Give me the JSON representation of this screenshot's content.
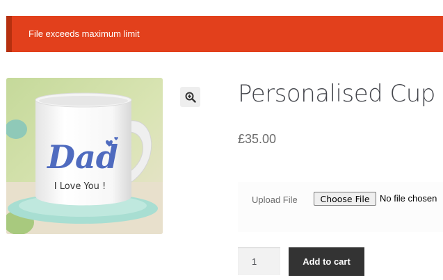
{
  "notice": {
    "message": "File exceeds maximum limit",
    "color": "#e2401c"
  },
  "product": {
    "title": "Personalised Cup",
    "price": "£35.00",
    "image": {
      "mug_text": "Dad",
      "mug_subtext": "I Love You !"
    },
    "zoom_icon": "magnify-plus-icon"
  },
  "upload": {
    "label": "Upload File",
    "button_label": "Choose File",
    "status": "No file chosen"
  },
  "cart": {
    "quantity": "1",
    "add_label": "Add to cart"
  }
}
